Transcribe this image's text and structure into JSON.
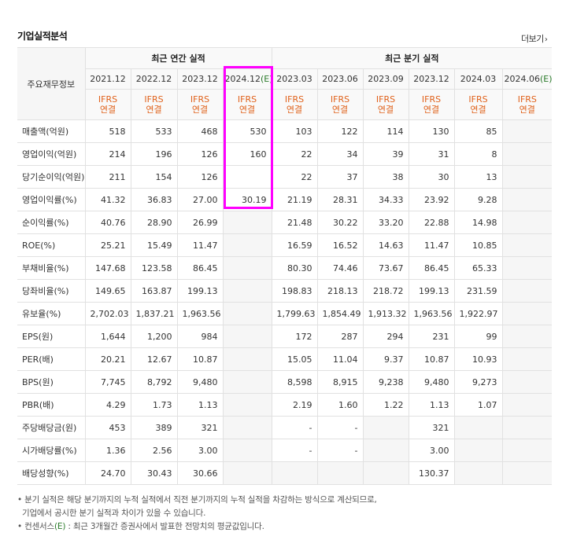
{
  "section_title": "기업실적분석",
  "more_link": "더보기",
  "more_icon": "chevron-right-icon",
  "corner_label": "주요재무정보",
  "groups": {
    "annual": "최근 연간 실적",
    "quarterly": "최근 분기 실적"
  },
  "periods": [
    {
      "year": "2021.12",
      "estimate": ""
    },
    {
      "year": "2022.12",
      "estimate": ""
    },
    {
      "year": "2023.12",
      "estimate": ""
    },
    {
      "year": "2024.12",
      "estimate": "(E)"
    },
    {
      "year": "2023.03",
      "estimate": ""
    },
    {
      "year": "2023.06",
      "estimate": ""
    },
    {
      "year": "2023.09",
      "estimate": ""
    },
    {
      "year": "2023.12",
      "estimate": ""
    },
    {
      "year": "2024.03",
      "estimate": ""
    },
    {
      "year": "2024.06",
      "estimate": "(E)"
    }
  ],
  "ifrs_label": [
    "IFRS",
    "연결"
  ],
  "rows": [
    {
      "label": "매출액(억원)",
      "values": [
        "518",
        "533",
        "468",
        "530",
        "103",
        "122",
        "114",
        "130",
        "85",
        ""
      ]
    },
    {
      "label": "영업이익(억원)",
      "values": [
        "214",
        "196",
        "126",
        "160",
        "22",
        "34",
        "39",
        "31",
        "8",
        ""
      ]
    },
    {
      "label": "당기순이익(억원)",
      "values": [
        "211",
        "154",
        "126",
        "",
        "22",
        "37",
        "38",
        "30",
        "13",
        ""
      ]
    },
    {
      "label": "영업이익률(%)",
      "values": [
        "41.32",
        "36.83",
        "27.00",
        "30.19",
        "21.19",
        "28.31",
        "34.33",
        "23.92",
        "9.28",
        ""
      ]
    },
    {
      "label": "순이익률(%)",
      "values": [
        "40.76",
        "28.90",
        "26.99",
        "",
        "21.48",
        "30.22",
        "33.20",
        "22.88",
        "14.98",
        ""
      ]
    },
    {
      "label": "ROE(%)",
      "values": [
        "25.21",
        "15.49",
        "11.47",
        "",
        "16.59",
        "16.52",
        "14.63",
        "11.47",
        "10.85",
        ""
      ]
    },
    {
      "label": "부채비율(%)",
      "values": [
        "147.68",
        "123.58",
        "86.45",
        "",
        "80.30",
        "74.46",
        "73.67",
        "86.45",
        "65.33",
        ""
      ]
    },
    {
      "label": "당좌비율(%)",
      "values": [
        "149.65",
        "163.87",
        "199.13",
        "",
        "198.83",
        "218.13",
        "218.72",
        "199.13",
        "231.59",
        ""
      ]
    },
    {
      "label": "유보율(%)",
      "values": [
        "2,702.03",
        "1,837.21",
        "1,963.56",
        "",
        "1,799.63",
        "1,854.49",
        "1,913.32",
        "1,963.56",
        "1,922.97",
        ""
      ]
    },
    {
      "label": "EPS(원)",
      "values": [
        "1,644",
        "1,200",
        "984",
        "",
        "172",
        "287",
        "294",
        "231",
        "99",
        ""
      ]
    },
    {
      "label": "PER(배)",
      "values": [
        "20.21",
        "12.67",
        "10.87",
        "",
        "15.05",
        "11.04",
        "9.37",
        "10.87",
        "10.93",
        ""
      ]
    },
    {
      "label": "BPS(원)",
      "values": [
        "7,745",
        "8,792",
        "9,480",
        "",
        "8,598",
        "8,915",
        "9,238",
        "9,480",
        "9,273",
        ""
      ]
    },
    {
      "label": "PBR(배)",
      "values": [
        "4.29",
        "1.73",
        "1.13",
        "",
        "2.19",
        "1.60",
        "1.22",
        "1.13",
        "1.07",
        ""
      ]
    },
    {
      "label": "주당배당금(원)",
      "values": [
        "453",
        "389",
        "321",
        "",
        "-",
        "-",
        "",
        "321",
        "",
        ""
      ]
    },
    {
      "label": "시가배당률(%)",
      "values": [
        "1.36",
        "2.56",
        "3.00",
        "",
        "-",
        "-",
        "",
        "3.00",
        "",
        ""
      ]
    },
    {
      "label": "배당성향(%)",
      "values": [
        "24.70",
        "30.43",
        "30.66",
        "",
        "",
        "",
        "",
        "130.37",
        "",
        ""
      ]
    }
  ],
  "dim_cells": {
    "col3_from_row": 4,
    "col9_from_row": 0,
    "col8_from_row": 13,
    "col4_from_row": 15,
    "col5_from_row": 15,
    "col6_from_row": 13
  },
  "highlight_color": "#ff00ff",
  "accent_color": "#e0621c",
  "estimate_color": "#2a7a2a",
  "notes": {
    "line1": "• 분기 실적은 해당 분기까지의 누적 실적에서 직전 분기까지의 누적 실적을 차감하는 방식으로 계산되므로,",
    "line2": "기업에서 공시한 분기 실적과 차이가 있을 수 있습니다.",
    "line3_prefix": "• 컨센서스",
    "line3_e": "(E)",
    "line3_suffix": " : 최근 3개월간 증권사에서 발표한 전망치의 평균값입니다."
  }
}
